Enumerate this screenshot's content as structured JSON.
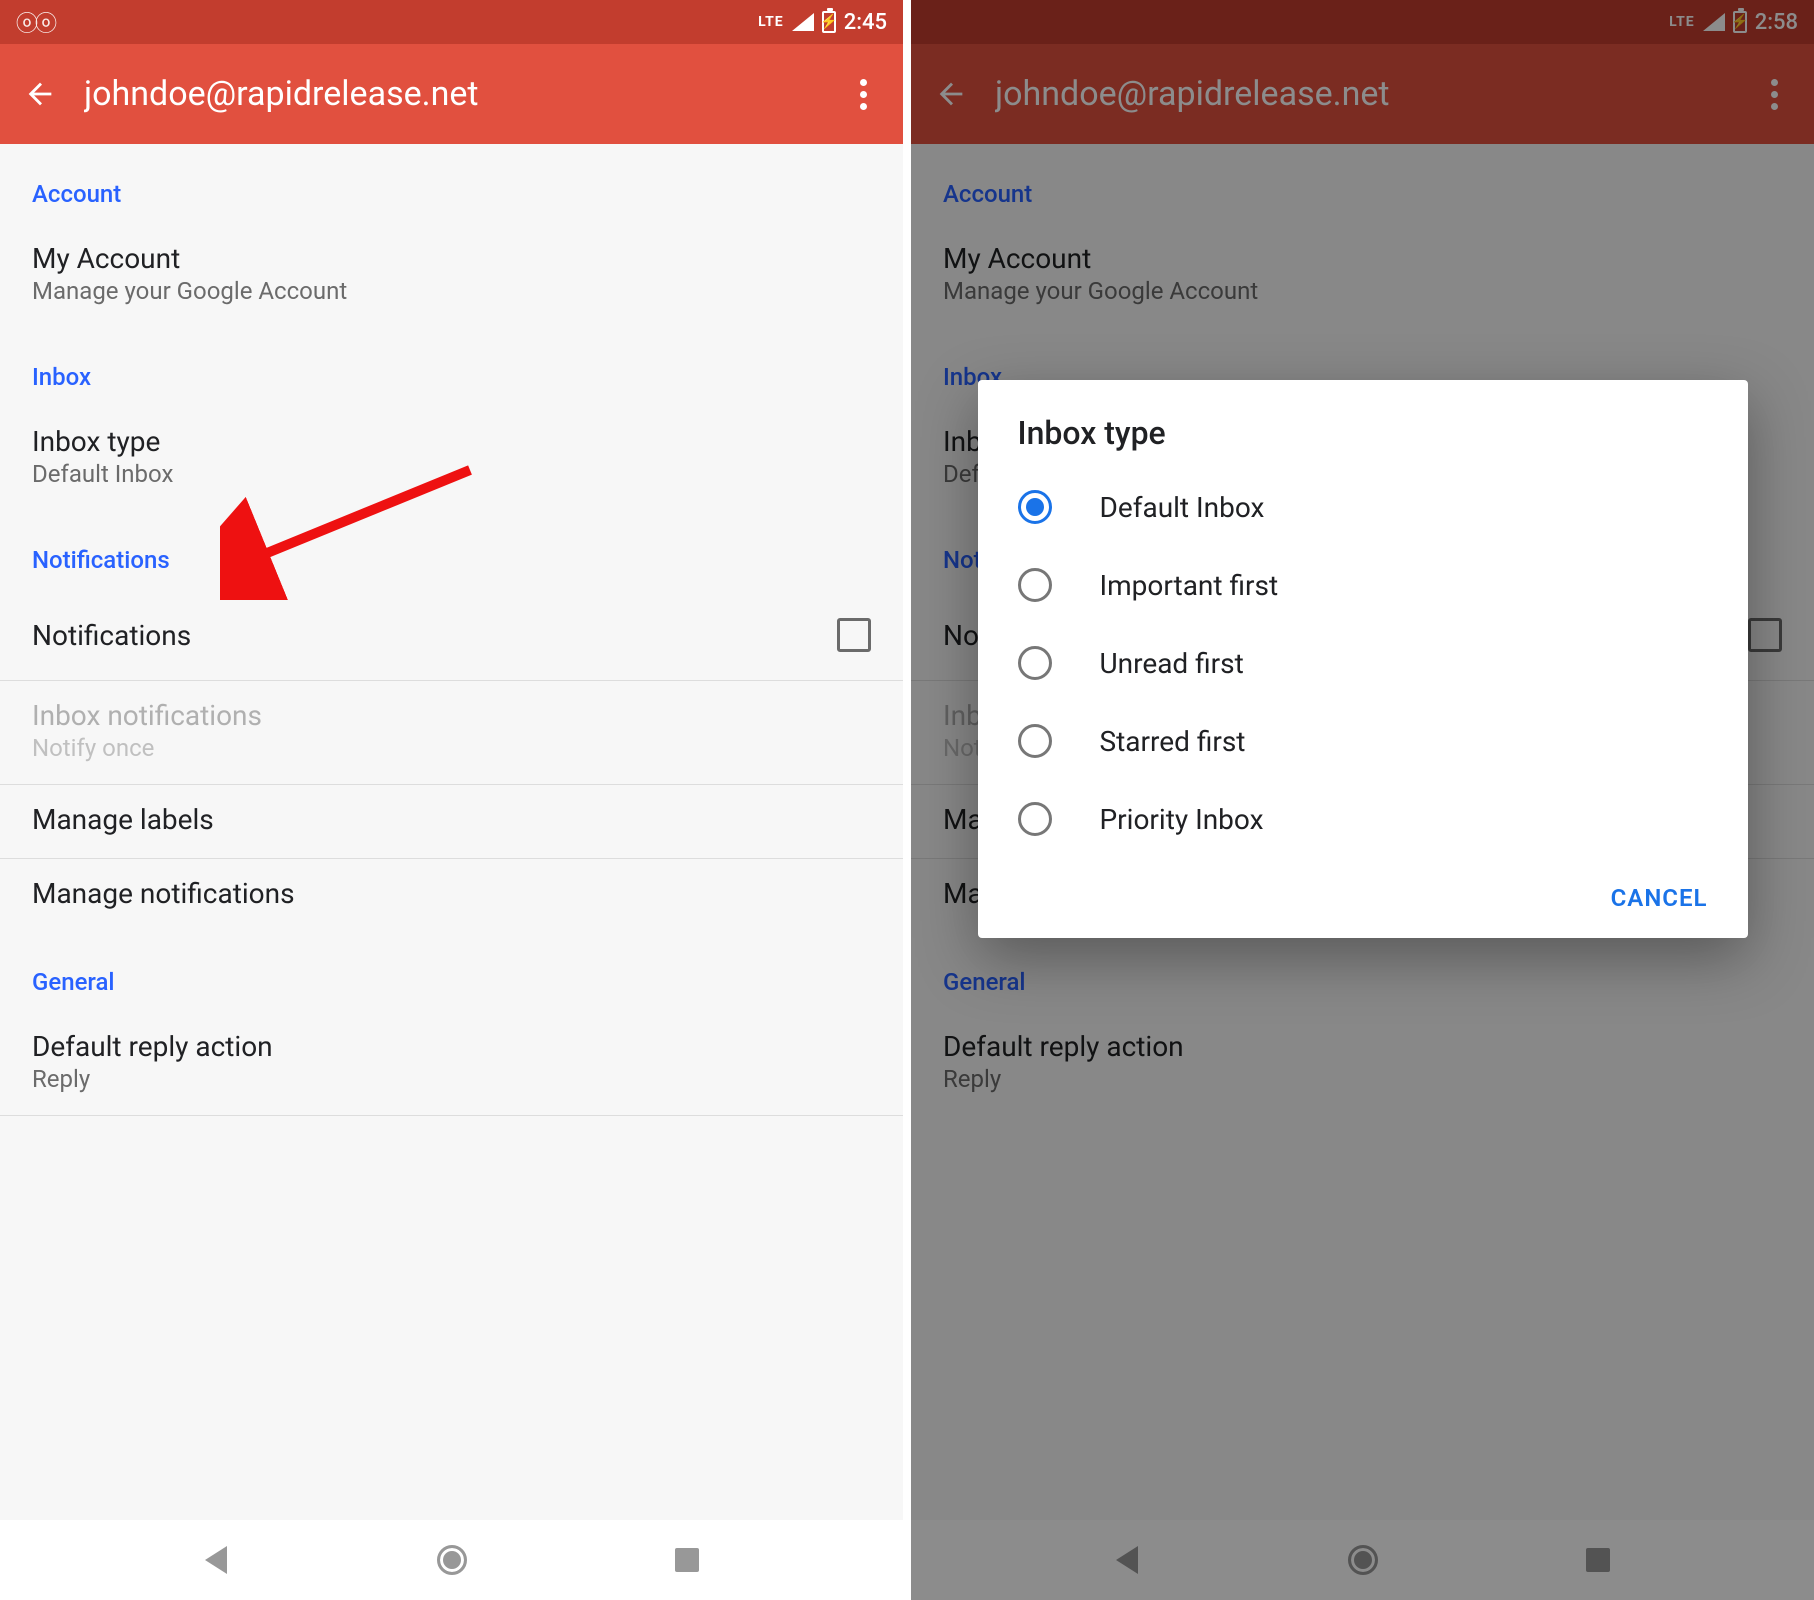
{
  "left": {
    "status": {
      "time": "2:45",
      "network": "LTE"
    },
    "appbar": {
      "title": "johndoe@rapidrelease.net"
    },
    "sections": {
      "account": {
        "label": "Account",
        "my_account_title": "My Account",
        "my_account_sub": "Manage your Google Account"
      },
      "inbox": {
        "label": "Inbox",
        "type_title": "Inbox type",
        "type_sub": "Default Inbox"
      },
      "notifications": {
        "label": "Notifications",
        "toggle_title": "Notifications",
        "inbox_notif_title": "Inbox notifications",
        "inbox_notif_sub": "Notify once",
        "manage_labels": "Manage labels",
        "manage_notifications": "Manage notifications"
      },
      "general": {
        "label": "General",
        "reply_title": "Default reply action",
        "reply_sub": "Reply"
      }
    }
  },
  "right": {
    "status": {
      "time": "2:58",
      "network": "LTE"
    },
    "appbar": {
      "title": "johndoe@rapidrelease.net"
    },
    "dialog": {
      "title": "Inbox type",
      "options": {
        "o0": "Default Inbox",
        "o1": "Important first",
        "o2": "Unread first",
        "o3": "Starred first",
        "o4": "Priority Inbox"
      },
      "selected_index": 0,
      "cancel": "CANCEL"
    }
  }
}
